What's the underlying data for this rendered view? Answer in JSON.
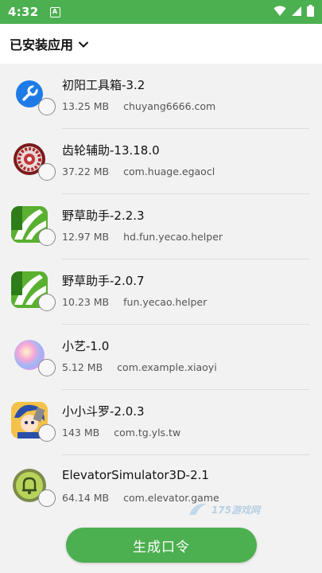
{
  "status_bar": {
    "time": "4:32",
    "notif_letter": "A"
  },
  "header": {
    "title": "已安装应用"
  },
  "apps": [
    {
      "name": "初阳工具箱-3.2",
      "size": "13.25 MB",
      "package": "chuyang6666.com",
      "icon": "wrench-icon"
    },
    {
      "name": "齿轮辅助-13.18.0",
      "size": "37.22 MB",
      "package": "com.huage.egaocl",
      "icon": "gear-icon"
    },
    {
      "name": "野草助手-2.2.3",
      "size": "12.97 MB",
      "package": "hd.fun.yecao.helper",
      "icon": "grass-icon"
    },
    {
      "name": "野草助手-2.0.7",
      "size": "10.23 MB",
      "package": "fun.yecao.helper",
      "icon": "grass-icon"
    },
    {
      "name": "小艺-1.0",
      "size": "5.12 MB",
      "package": "com.example.xiaoyi",
      "icon": "orb-icon"
    },
    {
      "name": "小小斗罗-2.0.3",
      "size": "143 MB",
      "package": "com.tg.yls.tw",
      "icon": "anime-character-icon"
    },
    {
      "name": "ElevatorSimulator3D-2.1",
      "size": "64.14 MB",
      "package": "com.elevator.game",
      "icon": "bell-icon"
    }
  ],
  "generate_button": {
    "label": "生成口令"
  },
  "watermark": {
    "text": "175游戏网"
  }
}
